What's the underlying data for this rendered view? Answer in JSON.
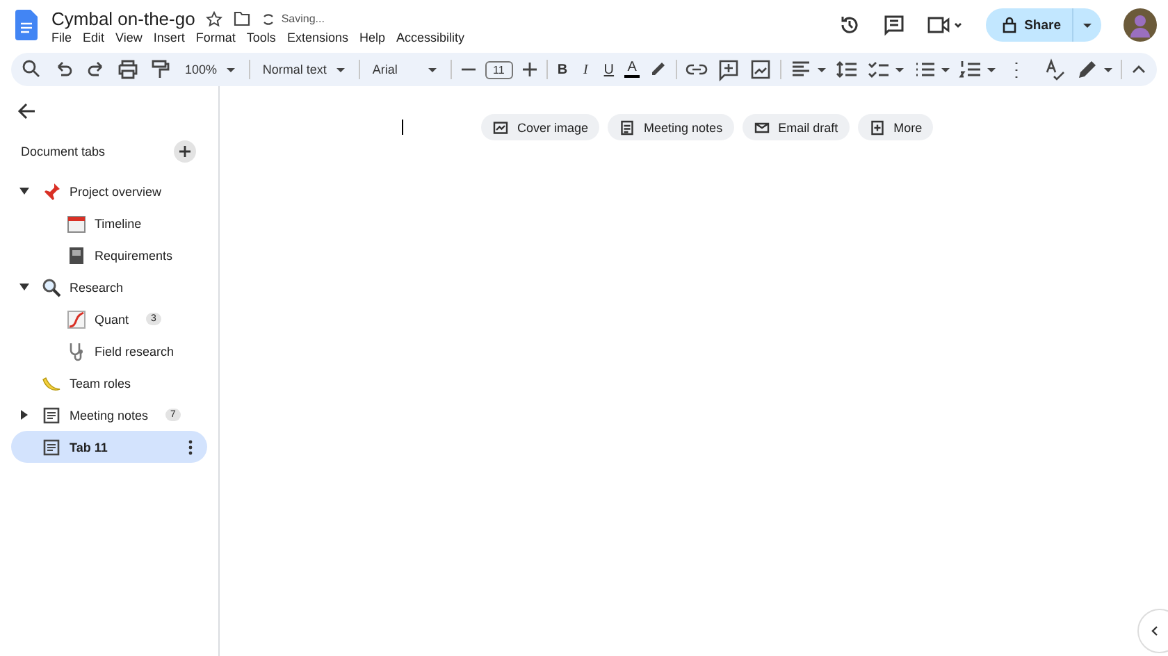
{
  "document": {
    "title": "Cymbal on-the-go",
    "status": "Saving..."
  },
  "menu": [
    "File",
    "Edit",
    "View",
    "Insert",
    "Format",
    "Tools",
    "Extensions",
    "Help",
    "Accessibility"
  ],
  "share_button": {
    "label": "Share"
  },
  "toolbar": {
    "zoom": "100%",
    "style": "Normal text",
    "font": "Arial",
    "font_size": "11",
    "format_buttons": [
      {
        "label": "B",
        "kind": "bold"
      },
      {
        "label": "I",
        "kind": "italic"
      },
      {
        "label": "U",
        "kind": "underline"
      },
      {
        "label": "A",
        "kind": "color"
      }
    ]
  },
  "sidebar": {
    "heading": "Document tabs",
    "tabs": [
      {
        "label": "Project overview",
        "kind": "pin",
        "expanded": true,
        "selected": false,
        "children": [
          {
            "label": "Timeline",
            "kind": "calendar",
            "selected": false
          },
          {
            "label": "Requirements",
            "kind": "book",
            "selected": false
          }
        ]
      },
      {
        "label": "Research",
        "kind": "magnifier",
        "expanded": true,
        "selected": false,
        "children": [
          {
            "label": "Quant",
            "kind": "chart",
            "badge": "3",
            "selected": false
          },
          {
            "label": "Field research",
            "kind": "stethoscope",
            "selected": false
          }
        ]
      },
      {
        "label": "Team roles",
        "kind": "banana",
        "selected": false
      },
      {
        "label": "Meeting notes",
        "kind": "doc",
        "expanded": false,
        "badge": "7",
        "selected": false
      },
      {
        "label": "Tab 11",
        "kind": "doc",
        "selected": true
      }
    ]
  },
  "chips": [
    {
      "label": "Cover image",
      "kind": "image"
    },
    {
      "label": "Meeting notes",
      "kind": "doc"
    },
    {
      "label": "Email draft",
      "kind": "mail"
    },
    {
      "label": "More",
      "kind": "more"
    }
  ]
}
